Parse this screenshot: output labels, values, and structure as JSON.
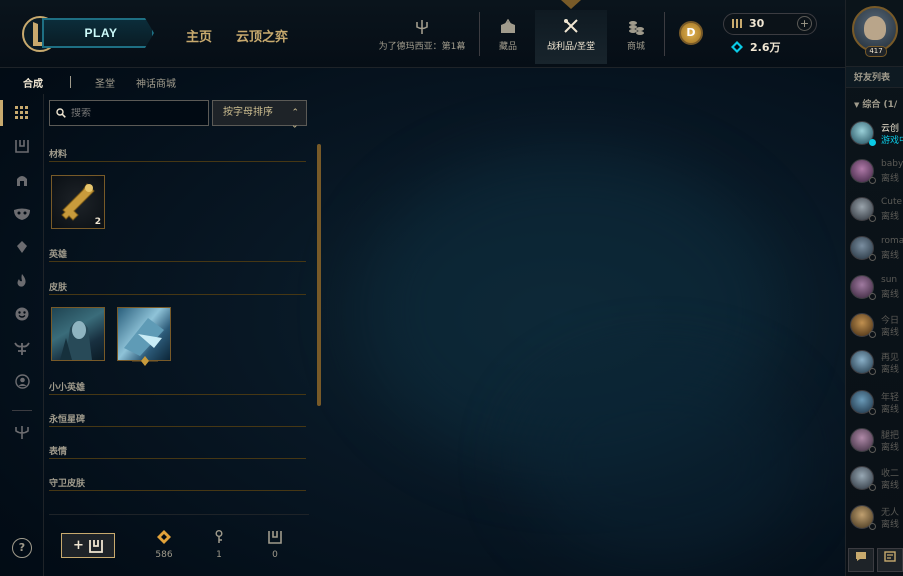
{
  "topbar": {
    "play_label": "PLAY",
    "home_label": "主页",
    "tft_label": "云顶之弈",
    "nav": [
      {
        "label": "为了德玛西亚：第1幕",
        "icon": "trident-icon"
      },
      {
        "label": "藏品",
        "icon": "collection-icon"
      },
      {
        "label": "战利品/圣堂",
        "icon": "loot-icon"
      },
      {
        "label": "商城",
        "icon": "store-icon"
      }
    ],
    "coin_label": "D",
    "blue_essence": "30",
    "riot_points": "2.6万",
    "plus_label": "+"
  },
  "profile": {
    "level": "417"
  },
  "subtabs": [
    {
      "label": "合成",
      "active": true
    },
    {
      "label": "圣堂",
      "active": false
    },
    {
      "label": "神话商城",
      "active": false
    }
  ],
  "search": {
    "placeholder": "搜索"
  },
  "sort": {
    "label": "按字母排序"
  },
  "sections": {
    "materials": "材料",
    "champions": "英雄",
    "skins": "皮肤",
    "little_legends": "小小英雄",
    "eternals": "永恒星碑",
    "emotes": "表情",
    "ward_skins": "守卫皮肤"
  },
  "items": {
    "key_count": "2"
  },
  "bottom": {
    "craft_label": "+",
    "orange_essence": "586",
    "keys": "1",
    "chests": "0"
  },
  "friends": {
    "title": "好友列表",
    "group": "综合 (1/",
    "list": [
      {
        "name": "云创",
        "status": "游戏中",
        "online": true
      },
      {
        "name": "baby",
        "status": "离线",
        "online": false
      },
      {
        "name": "Cute",
        "status": "离线",
        "online": false
      },
      {
        "name": "roma",
        "status": "离线",
        "online": false
      },
      {
        "name": "sun",
        "status": "离线",
        "online": false
      },
      {
        "name": "今日",
        "status": "离线",
        "online": false
      },
      {
        "name": "再见",
        "status": "离线",
        "online": false
      },
      {
        "name": "年轻",
        "status": "离线",
        "online": false
      },
      {
        "name": "腿把",
        "status": "离线",
        "online": false
      },
      {
        "name": "收二",
        "status": "离线",
        "online": false
      },
      {
        "name": "无人",
        "status": "离线",
        "online": false
      }
    ]
  },
  "help_label": "?"
}
